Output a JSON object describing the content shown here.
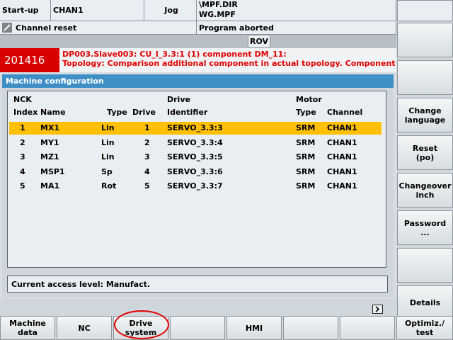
{
  "header": {
    "mode": "Start-up",
    "channel": "CHAN1",
    "operating_mode": "Jog",
    "program_path": "\\MPF.DIR",
    "program_file": "WG.MPF",
    "channel_status": "Channel reset",
    "program_status": "Program aborted",
    "rov": "ROV"
  },
  "alarm": {
    "number": "201416",
    "line1": "DP003.Slave003: CU_I_3.3:1 (1) component DM_11:",
    "line2": "Topology: Comparison additional component in actual topology. Component",
    "bg": "#d80000",
    "text_color": "#e00000"
  },
  "panel": {
    "title": "Machine configuration",
    "headers": {
      "nck": "NCK",
      "index": "Index",
      "name": "Name",
      "type": "Type",
      "drive": "Drive",
      "drive_group": "Drive",
      "identifier": "Identifier",
      "motor": "Motor",
      "motor_type": "Type",
      "channel": "Channel"
    },
    "rows": [
      {
        "index": "1",
        "name": "MX1",
        "type": "Lin",
        "drive": "1",
        "identifier": "SERVO_3.3:3",
        "motor_type": "SRM",
        "channel": "CHAN1"
      },
      {
        "index": "2",
        "name": "MY1",
        "type": "Lin",
        "drive": "2",
        "identifier": "SERVO_3.3:4",
        "motor_type": "SRM",
        "channel": "CHAN1"
      },
      {
        "index": "3",
        "name": "MZ1",
        "type": "Lin",
        "drive": "3",
        "identifier": "SERVO_3.3:5",
        "motor_type": "SRM",
        "channel": "CHAN1"
      },
      {
        "index": "4",
        "name": "MSP1",
        "type": "Sp",
        "drive": "4",
        "identifier": "SERVO_3.3:6",
        "motor_type": "SRM",
        "channel": "CHAN1"
      },
      {
        "index": "5",
        "name": "MA1",
        "type": "Rot",
        "drive": "5",
        "identifier": "SERVO_3.3:7",
        "motor_type": "SRM",
        "channel": "CHAN1"
      }
    ],
    "access_level": "Current access level: Manufact.",
    "selection_color": "#ffc000",
    "title_color": "#3f8fc7"
  },
  "vertical_softkeys": [
    "",
    "",
    "Change\nlanguage",
    "Reset\n(po)",
    "Changeover\ninch",
    "Password\n...",
    "",
    "Details"
  ],
  "horizontal_softkeys": [
    "Machine\ndata",
    "NC",
    "Drive\nsystem",
    "",
    "HMI",
    "",
    "",
    "Optimiz./\ntest"
  ],
  "icons": {
    "channel_reset": "pencil-slash-icon",
    "etc": "etc-arrow-icon"
  }
}
